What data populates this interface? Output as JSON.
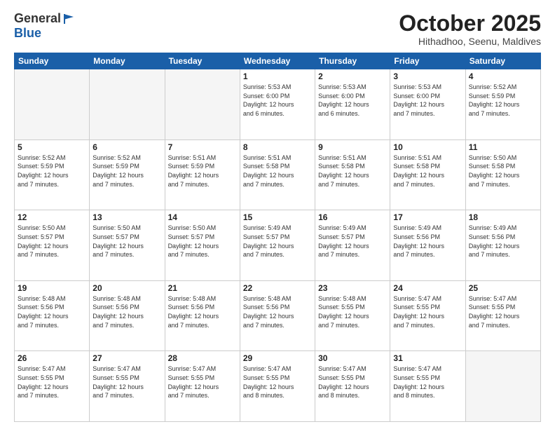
{
  "logo": {
    "general": "General",
    "blue": "Blue"
  },
  "title": "October 2025",
  "location": "Hithadhoo, Seenu, Maldives",
  "days_header": [
    "Sunday",
    "Monday",
    "Tuesday",
    "Wednesday",
    "Thursday",
    "Friday",
    "Saturday"
  ],
  "weeks": [
    [
      {
        "day": "",
        "info": ""
      },
      {
        "day": "",
        "info": ""
      },
      {
        "day": "",
        "info": ""
      },
      {
        "day": "1",
        "info": "Sunrise: 5:53 AM\nSunset: 6:00 PM\nDaylight: 12 hours\nand 6 minutes."
      },
      {
        "day": "2",
        "info": "Sunrise: 5:53 AM\nSunset: 6:00 PM\nDaylight: 12 hours\nand 6 minutes."
      },
      {
        "day": "3",
        "info": "Sunrise: 5:53 AM\nSunset: 6:00 PM\nDaylight: 12 hours\nand 7 minutes."
      },
      {
        "day": "4",
        "info": "Sunrise: 5:52 AM\nSunset: 5:59 PM\nDaylight: 12 hours\nand 7 minutes."
      }
    ],
    [
      {
        "day": "5",
        "info": "Sunrise: 5:52 AM\nSunset: 5:59 PM\nDaylight: 12 hours\nand 7 minutes."
      },
      {
        "day": "6",
        "info": "Sunrise: 5:52 AM\nSunset: 5:59 PM\nDaylight: 12 hours\nand 7 minutes."
      },
      {
        "day": "7",
        "info": "Sunrise: 5:51 AM\nSunset: 5:59 PM\nDaylight: 12 hours\nand 7 minutes."
      },
      {
        "day": "8",
        "info": "Sunrise: 5:51 AM\nSunset: 5:58 PM\nDaylight: 12 hours\nand 7 minutes."
      },
      {
        "day": "9",
        "info": "Sunrise: 5:51 AM\nSunset: 5:58 PM\nDaylight: 12 hours\nand 7 minutes."
      },
      {
        "day": "10",
        "info": "Sunrise: 5:51 AM\nSunset: 5:58 PM\nDaylight: 12 hours\nand 7 minutes."
      },
      {
        "day": "11",
        "info": "Sunrise: 5:50 AM\nSunset: 5:58 PM\nDaylight: 12 hours\nand 7 minutes."
      }
    ],
    [
      {
        "day": "12",
        "info": "Sunrise: 5:50 AM\nSunset: 5:57 PM\nDaylight: 12 hours\nand 7 minutes."
      },
      {
        "day": "13",
        "info": "Sunrise: 5:50 AM\nSunset: 5:57 PM\nDaylight: 12 hours\nand 7 minutes."
      },
      {
        "day": "14",
        "info": "Sunrise: 5:50 AM\nSunset: 5:57 PM\nDaylight: 12 hours\nand 7 minutes."
      },
      {
        "day": "15",
        "info": "Sunrise: 5:49 AM\nSunset: 5:57 PM\nDaylight: 12 hours\nand 7 minutes."
      },
      {
        "day": "16",
        "info": "Sunrise: 5:49 AM\nSunset: 5:57 PM\nDaylight: 12 hours\nand 7 minutes."
      },
      {
        "day": "17",
        "info": "Sunrise: 5:49 AM\nSunset: 5:56 PM\nDaylight: 12 hours\nand 7 minutes."
      },
      {
        "day": "18",
        "info": "Sunrise: 5:49 AM\nSunset: 5:56 PM\nDaylight: 12 hours\nand 7 minutes."
      }
    ],
    [
      {
        "day": "19",
        "info": "Sunrise: 5:48 AM\nSunset: 5:56 PM\nDaylight: 12 hours\nand 7 minutes."
      },
      {
        "day": "20",
        "info": "Sunrise: 5:48 AM\nSunset: 5:56 PM\nDaylight: 12 hours\nand 7 minutes."
      },
      {
        "day": "21",
        "info": "Sunrise: 5:48 AM\nSunset: 5:56 PM\nDaylight: 12 hours\nand 7 minutes."
      },
      {
        "day": "22",
        "info": "Sunrise: 5:48 AM\nSunset: 5:56 PM\nDaylight: 12 hours\nand 7 minutes."
      },
      {
        "day": "23",
        "info": "Sunrise: 5:48 AM\nSunset: 5:55 PM\nDaylight: 12 hours\nand 7 minutes."
      },
      {
        "day": "24",
        "info": "Sunrise: 5:47 AM\nSunset: 5:55 PM\nDaylight: 12 hours\nand 7 minutes."
      },
      {
        "day": "25",
        "info": "Sunrise: 5:47 AM\nSunset: 5:55 PM\nDaylight: 12 hours\nand 7 minutes."
      }
    ],
    [
      {
        "day": "26",
        "info": "Sunrise: 5:47 AM\nSunset: 5:55 PM\nDaylight: 12 hours\nand 7 minutes."
      },
      {
        "day": "27",
        "info": "Sunrise: 5:47 AM\nSunset: 5:55 PM\nDaylight: 12 hours\nand 7 minutes."
      },
      {
        "day": "28",
        "info": "Sunrise: 5:47 AM\nSunset: 5:55 PM\nDaylight: 12 hours\nand 7 minutes."
      },
      {
        "day": "29",
        "info": "Sunrise: 5:47 AM\nSunset: 5:55 PM\nDaylight: 12 hours\nand 8 minutes."
      },
      {
        "day": "30",
        "info": "Sunrise: 5:47 AM\nSunset: 5:55 PM\nDaylight: 12 hours\nand 8 minutes."
      },
      {
        "day": "31",
        "info": "Sunrise: 5:47 AM\nSunset: 5:55 PM\nDaylight: 12 hours\nand 8 minutes."
      },
      {
        "day": "",
        "info": ""
      }
    ]
  ]
}
